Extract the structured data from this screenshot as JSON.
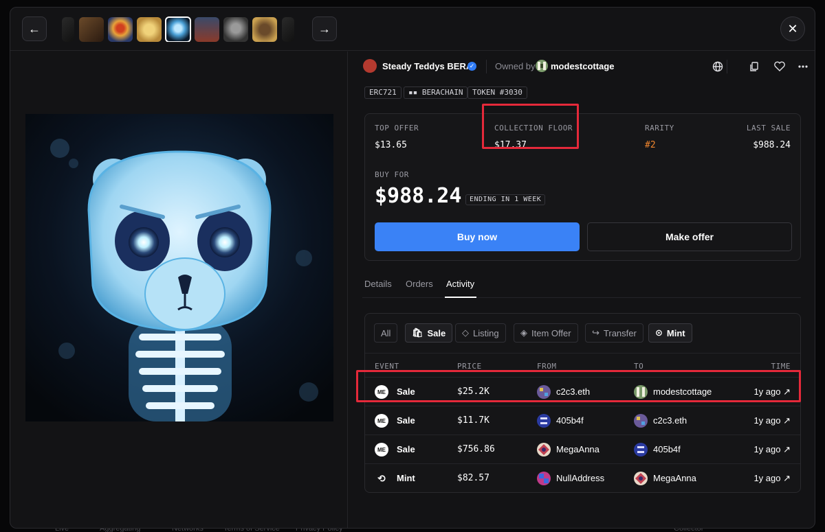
{
  "collection": {
    "name": "Steady Teddys BERA",
    "owned_label": "Owned by",
    "owner": "modestcottage"
  },
  "tags": [
    "ERC721",
    "BERACHAIN",
    "TOKEN #3030"
  ],
  "stats": {
    "top_offer_label": "TOP OFFER",
    "top_offer": "$13.65",
    "floor_label": "COLLECTION FLOOR",
    "floor": "$17.37",
    "rarity_label": "RARITY",
    "rarity": "#2",
    "last_sale_label": "LAST SALE",
    "last_sale": "$988.24"
  },
  "buy": {
    "label": "BUY FOR",
    "price": "$988.24",
    "ending": "ENDING IN 1 WEEK",
    "buy_button": "Buy now",
    "offer_button": "Make offer"
  },
  "tabs": [
    "Details",
    "Orders",
    "Activity"
  ],
  "filters": [
    "All",
    "Sale",
    "Listing",
    "Item Offer",
    "Transfer",
    "Mint"
  ],
  "columns": [
    "EVENT",
    "PRICE",
    "FROM",
    "TO",
    "TIME"
  ],
  "rows": [
    {
      "event": "Sale",
      "price": "$25.2K",
      "from": "c2c3.eth",
      "to": "modestcottage",
      "time": "1y ago ↗"
    },
    {
      "event": "Sale",
      "price": "$11.7K",
      "from": "405b4f",
      "to": "c2c3.eth",
      "time": "1y ago ↗"
    },
    {
      "event": "Sale",
      "price": "$756.86",
      "from": "MegaAnna",
      "to": "405b4f",
      "time": "1y ago ↗"
    },
    {
      "event": "Mint",
      "price": "$82.57",
      "from": "NullAddress",
      "to": "MegaAnna",
      "time": "1y ago ↗"
    }
  ],
  "marketplace_logo": "ME",
  "colors": {
    "accent": "#3a82f6",
    "rarity": "#f0862e",
    "highlight": "#e5293a"
  }
}
